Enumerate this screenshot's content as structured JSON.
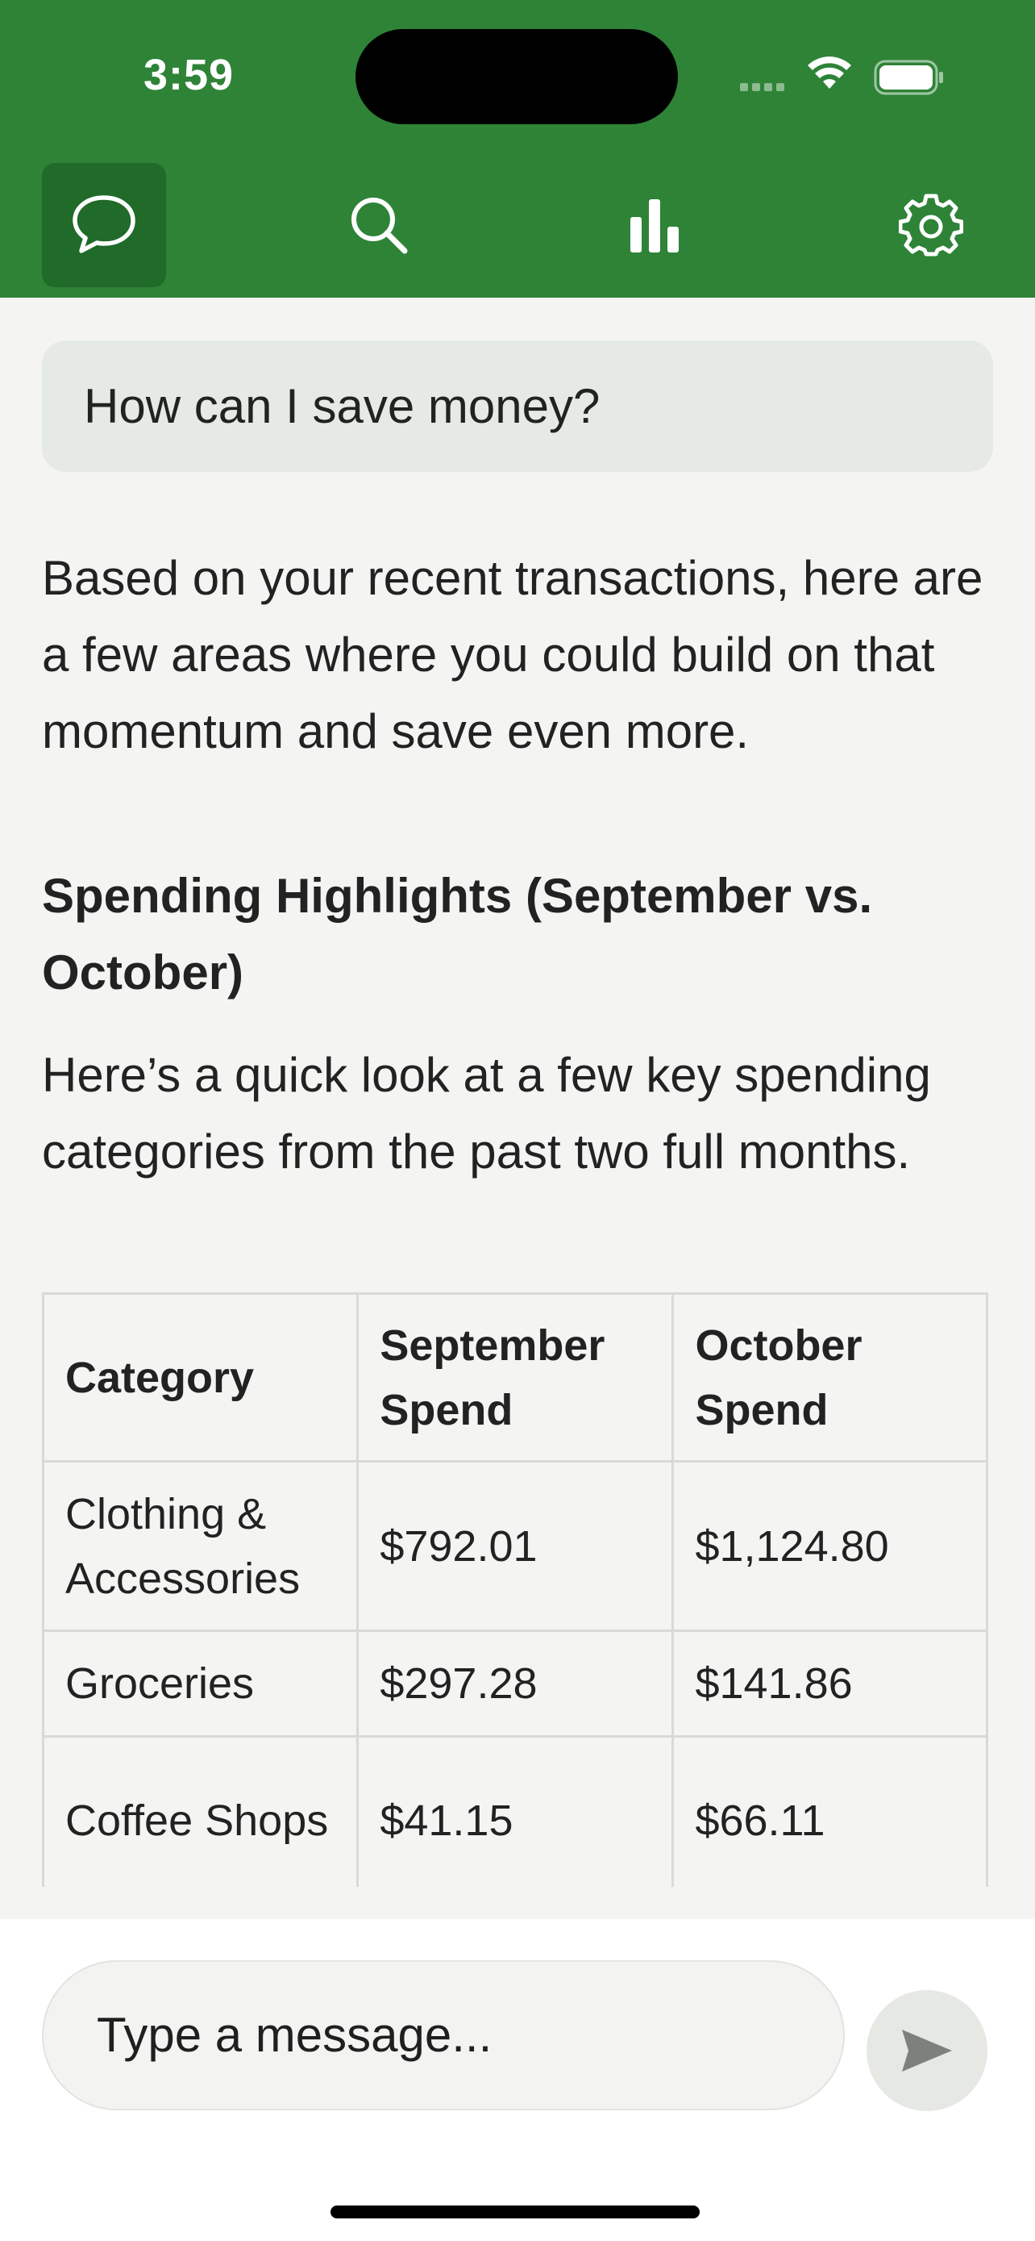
{
  "status_bar": {
    "time": "3:59"
  },
  "nav": {
    "items": [
      {
        "icon": "chat-bubble-icon",
        "active": true
      },
      {
        "icon": "search-icon",
        "active": false
      },
      {
        "icon": "bar-chart-icon",
        "active": false
      },
      {
        "icon": "gear-icon",
        "active": false
      }
    ]
  },
  "conversation": {
    "user_message": "How can I save money?",
    "reply_intro": "Based on your recent transactions, here are a few areas where you could build on that momentum and save even more.",
    "reply_heading": "Spending Highlights (September vs. October)",
    "reply_table_intro": "Here’s a quick look at a few key spending categories from the past two full months.",
    "table": {
      "headers": [
        "Category",
        "September Spend",
        "October Spend"
      ],
      "rows": [
        [
          "Clothing & Accessories",
          "$792.01",
          "$1,124.80"
        ],
        [
          "Groceries",
          "$297.28",
          "$141.86"
        ],
        [
          "Coffee Shops",
          "$41.15",
          "$66.11"
        ]
      ]
    }
  },
  "composer": {
    "placeholder": "Type a message..."
  },
  "colors": {
    "header_green": "#2e8337",
    "active_tab": "#206a2a",
    "background": "#f4f5f2"
  }
}
